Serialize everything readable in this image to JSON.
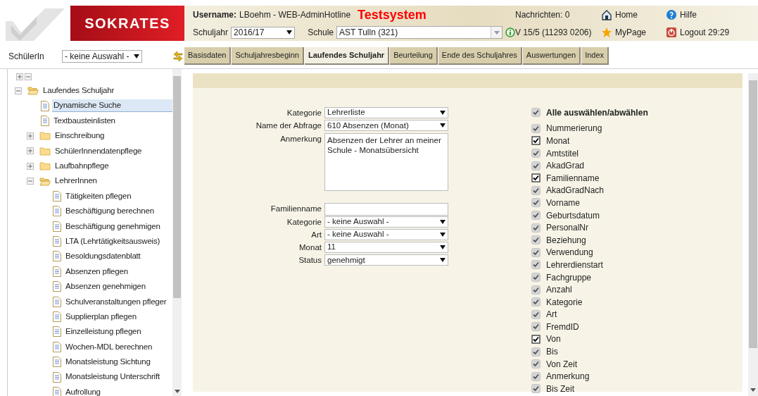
{
  "header": {
    "logo_text": "SOKRATES",
    "username_label": "Username:",
    "username": "LBoehm - WEB-AdminHotline",
    "system_label": "Testsystem",
    "schuljahr_label": "Schuljahr",
    "schuljahr": "2016/17",
    "schule_label": "Schule",
    "schule": "AST Tulln (321)",
    "messages": "Nachrichten: 0",
    "version": "V 15/5 (11293 0206)",
    "links": [
      {
        "kind": "home",
        "label": "Home"
      },
      {
        "kind": "help",
        "label": "Hilfe"
      },
      {
        "kind": "star",
        "label": "MyPage"
      },
      {
        "kind": "logout",
        "label": "Logout 29:29"
      }
    ]
  },
  "student": {
    "label": "SchülerIn",
    "value": "- keine Auswahl -"
  },
  "tabs": [
    {
      "label": "Basisdaten",
      "selected": false
    },
    {
      "label": "Schuljahresbeginn",
      "selected": false
    },
    {
      "label": "Laufendes Schuljahr",
      "selected": true
    },
    {
      "label": "Beurteilung",
      "selected": false
    },
    {
      "label": "Ende des Schuljahres",
      "selected": false
    },
    {
      "label": "Auswertungen",
      "selected": false
    },
    {
      "label": "Index",
      "selected": false
    }
  ],
  "tree": [
    {
      "kind": "folder",
      "label": "Laufendes Schuljahr",
      "expanded": true,
      "selected": false,
      "children": [
        {
          "kind": "page",
          "label": "Dynamische Suche",
          "selected": true
        },
        {
          "kind": "page",
          "label": "Textbausteinlisten",
          "selected": false
        },
        {
          "kind": "folder",
          "label": "Einschreibung",
          "expanded": false,
          "selected": false
        },
        {
          "kind": "folder",
          "label": "SchülerInnendatenpflege",
          "expanded": false,
          "selected": false
        },
        {
          "kind": "folder",
          "label": "Laufbahnpflege",
          "expanded": false,
          "selected": false
        },
        {
          "kind": "folder",
          "label": "LehrerInnen",
          "expanded": true,
          "selected": false,
          "children": [
            {
              "kind": "page",
              "label": "Tätigkeiten pflegen",
              "selected": false
            },
            {
              "kind": "page",
              "label": "Beschäftigung berechnen",
              "selected": false
            },
            {
              "kind": "page",
              "label": "Beschäftigung genehmigen",
              "selected": false
            },
            {
              "kind": "page",
              "label": "LTA (Lehrtätigkeitsausweis)",
              "selected": false
            },
            {
              "kind": "page",
              "label": "Besoldungsdatenblatt",
              "selected": false
            },
            {
              "kind": "page",
              "label": "Absenzen pflegen",
              "selected": false
            },
            {
              "kind": "page",
              "label": "Absenzen genehmigen",
              "selected": false
            },
            {
              "kind": "page",
              "label": "Schulveranstaltungen pfleger",
              "selected": false
            },
            {
              "kind": "page",
              "label": "Supplierplan pflegen",
              "selected": false
            },
            {
              "kind": "page",
              "label": "Einzelleistung pflegen",
              "selected": false
            },
            {
              "kind": "page",
              "label": "Wochen-MDL berechnen",
              "selected": false
            },
            {
              "kind": "page",
              "label": "Monatsleistung Sichtung",
              "selected": false
            },
            {
              "kind": "page",
              "label": "Monatsleistung Unterschrift",
              "selected": false
            },
            {
              "kind": "page",
              "label": "Aufrollung",
              "selected": false
            }
          ]
        }
      ]
    }
  ],
  "form": {
    "groups": [
      [
        {
          "label": "Kategorie",
          "kind": "select",
          "value": "Lehrerliste"
        },
        {
          "label": "Name der Abfrage",
          "kind": "select",
          "value": "610 Absenzen (Monat)"
        },
        {
          "label": "Anmerkung",
          "kind": "textarea",
          "value": "Absenzen der Lehrer an meiner Schule - Monatsübersicht"
        }
      ],
      [
        {
          "label": "Familienname",
          "kind": "text"
        },
        {
          "label": "Kategorie",
          "kind": "select",
          "value": "- keine Auswahl -"
        },
        {
          "label": "Art",
          "kind": "select",
          "value": "- keine Auswahl -"
        },
        {
          "label": "Monat",
          "kind": "select",
          "value": "11"
        },
        {
          "label": "Status",
          "kind": "select",
          "value": "genehmigt"
        }
      ]
    ]
  },
  "columns": {
    "all": {
      "label": "Alle auswählen/abwählen",
      "checked": true,
      "disabled": true
    },
    "items": [
      {
        "label": "Nummerierung",
        "checked": true,
        "disabled": true
      },
      {
        "label": "Monat",
        "checked": true,
        "disabled": false
      },
      {
        "label": "Amtstitel",
        "checked": true,
        "disabled": true
      },
      {
        "label": "AkadGrad",
        "checked": true,
        "disabled": true
      },
      {
        "label": "Familienname",
        "checked": true,
        "disabled": false
      },
      {
        "label": "AkadGradNach",
        "checked": true,
        "disabled": true
      },
      {
        "label": "Vorname",
        "checked": true,
        "disabled": true
      },
      {
        "label": "Geburtsdatum",
        "checked": true,
        "disabled": true
      },
      {
        "label": "PersonalNr",
        "checked": true,
        "disabled": true
      },
      {
        "label": "Beziehung",
        "checked": true,
        "disabled": true
      },
      {
        "label": "Verwendung",
        "checked": true,
        "disabled": true
      },
      {
        "label": "Lehrerdienstart",
        "checked": true,
        "disabled": true
      },
      {
        "label": "Fachgruppe",
        "checked": true,
        "disabled": true
      },
      {
        "label": "Anzahl",
        "checked": true,
        "disabled": true
      },
      {
        "label": "Kategorie",
        "checked": true,
        "disabled": true
      },
      {
        "label": "Art",
        "checked": true,
        "disabled": true
      },
      {
        "label": "FremdID",
        "checked": true,
        "disabled": true
      },
      {
        "label": "Von",
        "checked": true,
        "disabled": false
      },
      {
        "label": "Bis",
        "checked": true,
        "disabled": true
      },
      {
        "label": "Von Zeit",
        "checked": true,
        "disabled": true
      },
      {
        "label": "Anmerkung",
        "checked": true,
        "disabled": true
      },
      {
        "label": "Bis Zeit",
        "checked": true,
        "disabled": true
      }
    ]
  }
}
